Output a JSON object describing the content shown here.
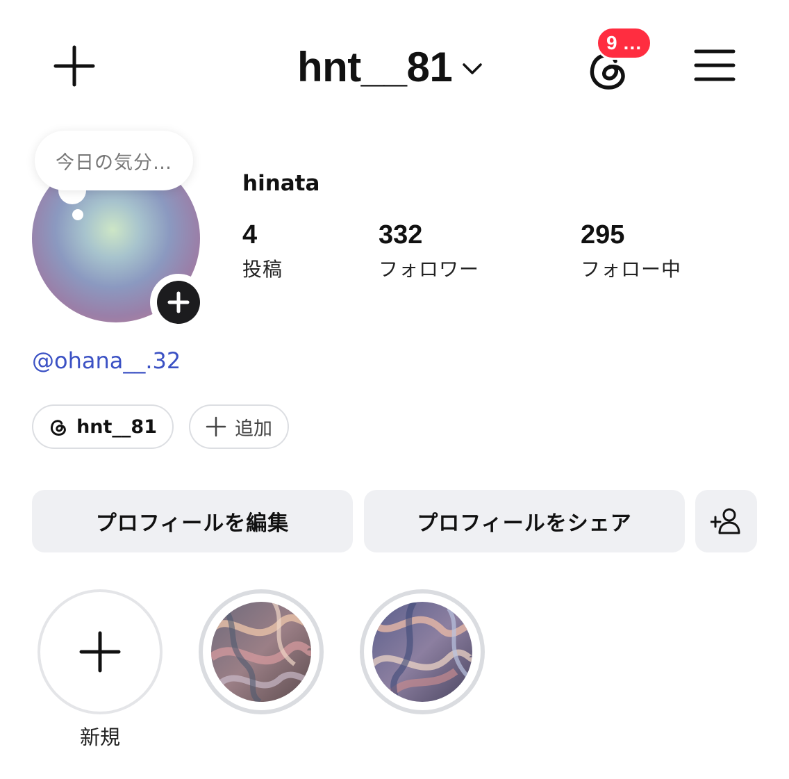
{
  "header": {
    "username": "hnt__81",
    "notification_badge": "9 …",
    "icons": {
      "create": "plus-icon",
      "account_switch": "chevron-down-icon",
      "threads": "threads-icon",
      "menu": "hamburger-menu-icon"
    },
    "badge_color": "#ff2d40"
  },
  "profile": {
    "note_placeholder": "今日の気分…",
    "display_name": "hinata",
    "stats": [
      {
        "value": "4",
        "label": "投稿"
      },
      {
        "value": "332",
        "label": "フォロワー"
      },
      {
        "value": "295",
        "label": "フォロー中"
      }
    ],
    "mention": "@ohana__.32",
    "mention_color": "#3b51c4"
  },
  "chips": {
    "threads_handle": "hnt__81",
    "add_label": "追加"
  },
  "actions": {
    "edit_profile": "プロフィールを編集",
    "share_profile": "プロフィールをシェア",
    "discover_people_icon": "add-person-icon"
  },
  "highlights": {
    "new_label": "新規",
    "items": [
      {
        "type": "new"
      },
      {
        "type": "highlight",
        "cover": "marble-swirl-pink"
      },
      {
        "type": "highlight",
        "cover": "marble-swirl-blue"
      }
    ]
  }
}
